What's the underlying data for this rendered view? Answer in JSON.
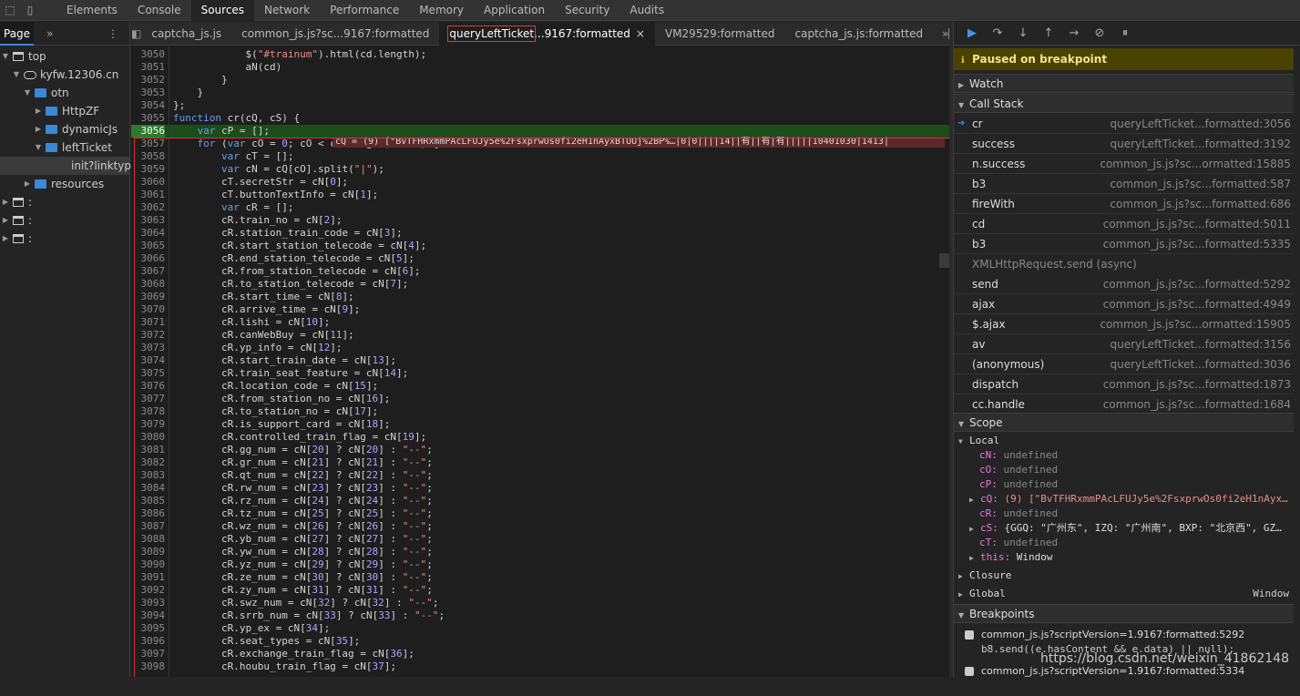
{
  "toolbar": {
    "tabs": [
      "Elements",
      "Console",
      "Sources",
      "Network",
      "Performance",
      "Memory",
      "Application",
      "Security",
      "Audits"
    ],
    "active": "Sources"
  },
  "navigator": {
    "tab": "Page",
    "more": "»",
    "tree": [
      {
        "label": "top",
        "kind": "window",
        "open": true,
        "depth": 0
      },
      {
        "label": "kyfw.12306.cn",
        "kind": "cloud",
        "open": true,
        "depth": 1
      },
      {
        "label": "otn",
        "kind": "folder",
        "open": true,
        "depth": 2
      },
      {
        "label": "HttpZF",
        "kind": "folder",
        "open": false,
        "depth": 3
      },
      {
        "label": "dynamicJs",
        "kind": "folder",
        "open": false,
        "depth": 3
      },
      {
        "label": "leftTicket",
        "kind": "folder",
        "open": true,
        "depth": 3
      },
      {
        "label": "init?linktype",
        "kind": "file",
        "open": false,
        "depth": 4
      },
      {
        "label": "resources",
        "kind": "folder",
        "open": false,
        "depth": 2
      },
      {
        "label": ":",
        "kind": "window",
        "open": false,
        "depth": 0
      },
      {
        "label": ":",
        "kind": "window",
        "open": false,
        "depth": 0
      },
      {
        "label": ":",
        "kind": "window",
        "open": false,
        "depth": 0
      }
    ]
  },
  "editor": {
    "tabs": [
      {
        "name": "captcha_js.js",
        "suffix": "",
        "active": false
      },
      {
        "name": "common_js.js?sc...9167:formatted",
        "suffix": "",
        "active": false
      },
      {
        "name": "queryLeftTicket",
        "suffix": "...9167:formatted",
        "active": true
      },
      {
        "name": "VM29529:formatted",
        "suffix": "",
        "active": false
      },
      {
        "name": "captcha_js.js:formatted",
        "suffix": "",
        "active": false
      }
    ],
    "more": "»",
    "close": "×",
    "current_line": 3056,
    "inline_value": "cQ = (9) [\"BvTFHRxmmPAcLFUJy5e%2FsxprwOs0fi2eH1nAyxBTUUj%2BP%…|0|0||||14||有||有|有|||||10401030|1413|",
    "lines": [
      {
        "n": 3050,
        "h": "            $(<s>\"#trainum\"</s>).html(cd.length);"
      },
      {
        "n": 3051,
        "h": "            aN(cd)"
      },
      {
        "n": 3052,
        "h": "        }"
      },
      {
        "n": 3053,
        "h": "    }"
      },
      {
        "n": 3054,
        "h": "};"
      },
      {
        "n": 3055,
        "h": "<k>function</k> cr(cQ, cS) {"
      },
      {
        "n": 3056,
        "h": "    <k>var</k> cP = [];"
      },
      {
        "n": 3057,
        "h": "    <k>for</k> (<k>var</k> cO = <m>0</m>; cO &lt; cQ.length; cO++) {"
      },
      {
        "n": 3058,
        "h": "        <k>var</k> cT = [];"
      },
      {
        "n": 3059,
        "h": "        <k>var</k> cN = cQ[cO].split(<s>\"|\"</s>);"
      },
      {
        "n": 3060,
        "h": "        cT.secretStr = cN[<m>0</m>];"
      },
      {
        "n": 3061,
        "h": "        cT.buttonTextInfo = cN[<m>1</m>];"
      },
      {
        "n": 3062,
        "h": "        <k>var</k> cR = [];"
      },
      {
        "n": 3063,
        "h": "        cR.train_no = cN[<m>2</m>];"
      },
      {
        "n": 3064,
        "h": "        cR.station_train_code = cN[<m>3</m>];"
      },
      {
        "n": 3065,
        "h": "        cR.start_station_telecode = cN[<m>4</m>];"
      },
      {
        "n": 3066,
        "h": "        cR.end_station_telecode = cN[<m>5</m>];"
      },
      {
        "n": 3067,
        "h": "        cR.from_station_telecode = cN[<m>6</m>];"
      },
      {
        "n": 3068,
        "h": "        cR.to_station_telecode = cN[<m>7</m>];"
      },
      {
        "n": 3069,
        "h": "        cR.start_time = cN[<m>8</m>];"
      },
      {
        "n": 3070,
        "h": "        cR.arrive_time = cN[<m>9</m>];"
      },
      {
        "n": 3071,
        "h": "        cR.lishi = cN[<m>10</m>];"
      },
      {
        "n": 3072,
        "h": "        cR.canWebBuy = cN[<m>11</m>];"
      },
      {
        "n": 3073,
        "h": "        cR.yp_info = cN[<m>12</m>];"
      },
      {
        "n": 3074,
        "h": "        cR.start_train_date = cN[<m>13</m>];"
      },
      {
        "n": 3075,
        "h": "        cR.train_seat_feature = cN[<m>14</m>];"
      },
      {
        "n": 3076,
        "h": "        cR.location_code = cN[<m>15</m>];"
      },
      {
        "n": 3077,
        "h": "        cR.from_station_no = cN[<m>16</m>];"
      },
      {
        "n": 3078,
        "h": "        cR.to_station_no = cN[<m>17</m>];"
      },
      {
        "n": 3079,
        "h": "        cR.is_support_card = cN[<m>18</m>];"
      },
      {
        "n": 3080,
        "h": "        cR.controlled_train_flag = cN[<m>19</m>];"
      },
      {
        "n": 3081,
        "h": "        cR.gg_num = cN[<m>20</m>] ? cN[<m>20</m>] : <s>\"--\"</s>;"
      },
      {
        "n": 3082,
        "h": "        cR.gr_num = cN[<m>21</m>] ? cN[<m>21</m>] : <s>\"--\"</s>;"
      },
      {
        "n": 3083,
        "h": "        cR.qt_num = cN[<m>22</m>] ? cN[<m>22</m>] : <s>\"--\"</s>;"
      },
      {
        "n": 3084,
        "h": "        cR.rw_num = cN[<m>23</m>] ? cN[<m>23</m>] : <s>\"--\"</s>;"
      },
      {
        "n": 3085,
        "h": "        cR.rz_num = cN[<m>24</m>] ? cN[<m>24</m>] : <s>\"--\"</s>;"
      },
      {
        "n": 3086,
        "h": "        cR.tz_num = cN[<m>25</m>] ? cN[<m>25</m>] : <s>\"--\"</s>;"
      },
      {
        "n": 3087,
        "h": "        cR.wz_num = cN[<m>26</m>] ? cN[<m>26</m>] : <s>\"--\"</s>;"
      },
      {
        "n": 3088,
        "h": "        cR.yb_num = cN[<m>27</m>] ? cN[<m>27</m>] : <s>\"--\"</s>;"
      },
      {
        "n": 3089,
        "h": "        cR.yw_num = cN[<m>28</m>] ? cN[<m>28</m>] : <s>\"--\"</s>;"
      },
      {
        "n": 3090,
        "h": "        cR.yz_num = cN[<m>29</m>] ? cN[<m>29</m>] : <s>\"--\"</s>;"
      },
      {
        "n": 3091,
        "h": "        cR.ze_num = cN[<m>30</m>] ? cN[<m>30</m>] : <s>\"--\"</s>;"
      },
      {
        "n": 3092,
        "h": "        cR.zy_num = cN[<m>31</m>] ? cN[<m>31</m>] : <s>\"--\"</s>;"
      },
      {
        "n": 3093,
        "h": "        cR.swz_num = cN[<m>32</m>] ? cN[<m>32</m>] : <s>\"--\"</s>;"
      },
      {
        "n": 3094,
        "h": "        cR.srrb_num = cN[<m>33</m>] ? cN[<m>33</m>] : <s>\"--\"</s>;"
      },
      {
        "n": 3095,
        "h": "        cR.yp_ex = cN[<m>34</m>];"
      },
      {
        "n": 3096,
        "h": "        cR.seat_types = cN[<m>35</m>];"
      },
      {
        "n": 3097,
        "h": "        cR.exchange_train_flag = cN[<m>36</m>];"
      },
      {
        "n": 3098,
        "h": "        cR.houbu_train_flag = cN[<m>37</m>];"
      }
    ]
  },
  "debugger": {
    "paused": "Paused on breakpoint",
    "watch": "Watch",
    "call_stack_title": "Call Stack",
    "call_stack": [
      {
        "fn": "cr",
        "loc": "queryLeftTicket...formatted:3056",
        "current": true
      },
      {
        "fn": "success",
        "loc": "queryLeftTicket...formatted:3192"
      },
      {
        "fn": "n.success",
        "loc": "common_js.js?sc...ormatted:15885"
      },
      {
        "fn": "b3",
        "loc": "common_js.js?sc...formatted:587"
      },
      {
        "fn": "fireWith",
        "loc": "common_js.js?sc...formatted:686"
      },
      {
        "fn": "cd",
        "loc": "common_js.js?sc...formatted:5011"
      },
      {
        "fn": "b3",
        "loc": "common_js.js?sc...formatted:5335"
      },
      {
        "fn": "XMLHttpRequest.send (async)",
        "loc": "",
        "async": true
      },
      {
        "fn": "send",
        "loc": "common_js.js?sc...formatted:5292"
      },
      {
        "fn": "ajax",
        "loc": "common_js.js?sc...formatted:4949"
      },
      {
        "fn": "$.ajax",
        "loc": "common_js.js?sc...ormatted:15905"
      },
      {
        "fn": "av",
        "loc": "queryLeftTicket...formatted:3156"
      },
      {
        "fn": "(anonymous)",
        "loc": "queryLeftTicket...formatted:3036"
      },
      {
        "fn": "dispatch",
        "loc": "common_js.js?sc...formatted:1873"
      },
      {
        "fn": "cc.handle",
        "loc": "common_js.js?sc...formatted:1684"
      }
    ],
    "scope_title": "Scope",
    "local_title": "Local",
    "locals": [
      {
        "k": "cN:",
        "v": "undefined",
        "expand": false,
        "type": "u"
      },
      {
        "k": "cO:",
        "v": "undefined",
        "expand": false,
        "type": "u"
      },
      {
        "k": "cP:",
        "v": "undefined",
        "expand": false,
        "type": "u"
      },
      {
        "k": "cQ:",
        "v": "(9) [\"BvTFHRxmmPAcLFUJy5e%2FsxprwOs0fi2eH1nAyx…",
        "expand": true,
        "type": "s"
      },
      {
        "k": "cR:",
        "v": "undefined",
        "expand": false,
        "type": "u"
      },
      {
        "k": "cS:",
        "v": "{GGQ: \"广州东\", IZQ: \"广州南\", BXP: \"北京西\", GZ…",
        "expand": true,
        "type": "o"
      },
      {
        "k": "cT:",
        "v": "undefined",
        "expand": false,
        "type": "u"
      },
      {
        "k": "this:",
        "v": "Window",
        "expand": true,
        "type": "w"
      }
    ],
    "closure": "Closure",
    "global": "Global",
    "global_value": "Window",
    "breakpoints_title": "Breakpoints",
    "breakpoints": [
      {
        "file": "common_js.js?scriptVersion=1.9167:formatted:5292",
        "code": "b8.send((e.hasContent && e.data) || null);"
      },
      {
        "file": "common_js.js?scriptVersion=1.9167:formatted:5334",
        "code": ""
      }
    ]
  },
  "watermark": "https://blog.csdn.net/weixin_41862148"
}
